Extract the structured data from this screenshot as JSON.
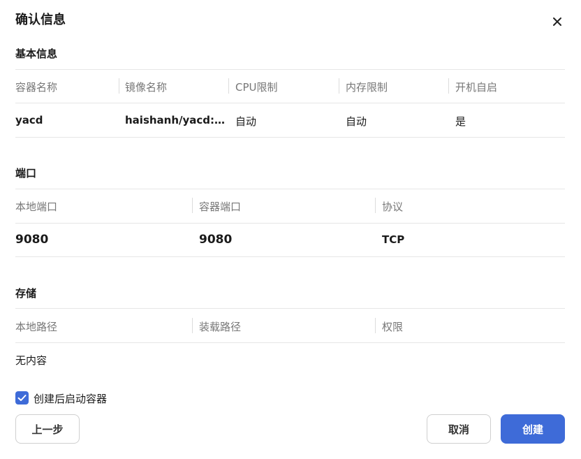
{
  "dialog": {
    "title": "确认信息",
    "close_icon": "close-icon"
  },
  "basic": {
    "title": "基本信息",
    "headers": [
      "容器名称",
      "镜像名称",
      "CPU限制",
      "内存限制",
      "开机自启"
    ],
    "values": [
      "yacd",
      "haishanh/yacd:la...",
      "自动",
      "自动",
      "是"
    ]
  },
  "ports": {
    "title": "端口",
    "headers": [
      "本地端口",
      "容器端口",
      "协议"
    ],
    "rows": [
      [
        "9080",
        "9080",
        "TCP"
      ]
    ]
  },
  "storage": {
    "title": "存储",
    "headers": [
      "本地路径",
      "装载路径",
      "权限"
    ],
    "empty_text": "无内容"
  },
  "start_after_create": {
    "label": "创建后启动容器",
    "checked": true
  },
  "buttons": {
    "prev": "上一步",
    "cancel": "取消",
    "create": "创建"
  },
  "colors": {
    "primary": "#3e6bd8",
    "border": "#e6e6e6",
    "muted_text": "#777777"
  }
}
